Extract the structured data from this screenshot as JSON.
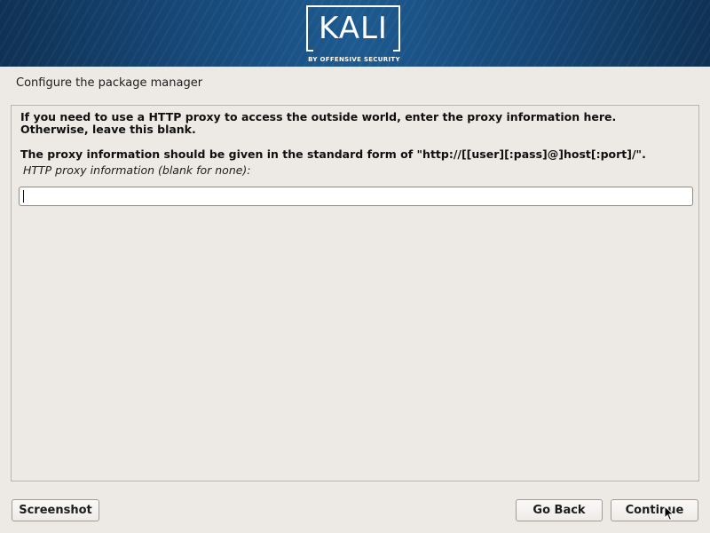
{
  "banner": {
    "logo_text": "KALI",
    "logo_subtitle": "BY OFFENSIVE SECURITY"
  },
  "page": {
    "title": "Configure the package manager"
  },
  "panel": {
    "description_line1": "If you need to use a HTTP proxy to access the outside world, enter the proxy information here.",
    "description_line2": "Otherwise, leave this blank.",
    "description_line3": "The proxy information should be given in the standard form of \"http://[[user][:pass]@]host[:port]/\".",
    "field_label": "HTTP proxy information (blank for none):",
    "proxy_value": ""
  },
  "buttons": {
    "screenshot": "Screenshot",
    "go_back": "Go Back",
    "continue": "Continue"
  },
  "colors": {
    "background": "#edeae5",
    "banner": "#17497a"
  },
  "icons": {
    "pointer": "mouse-pointer-icon"
  }
}
